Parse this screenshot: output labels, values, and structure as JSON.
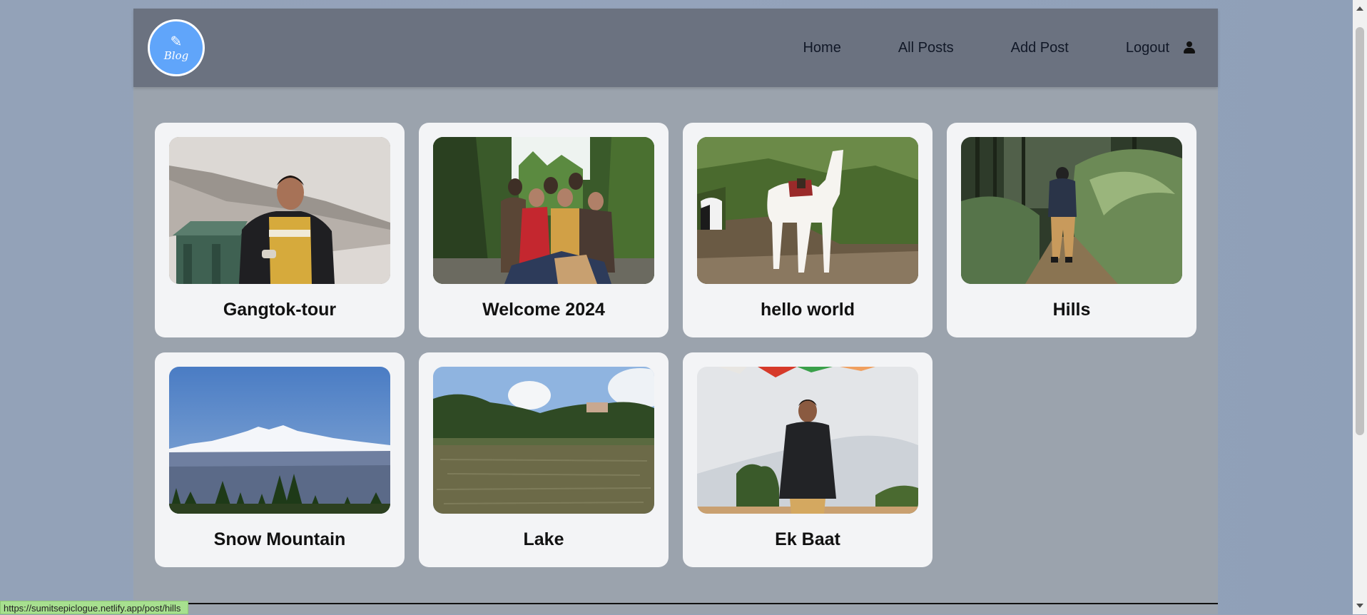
{
  "brand": {
    "logo_text": "Blog"
  },
  "nav": {
    "items": [
      {
        "label": "Home"
      },
      {
        "label": "All Posts"
      },
      {
        "label": "Add Post"
      },
      {
        "label": "Logout"
      }
    ],
    "profile_icon": "user-icon"
  },
  "posts": [
    {
      "title": "Gangtok-tour",
      "image": "snowy-hillside-portrait"
    },
    {
      "title": "Welcome 2024",
      "image": "group-in-forest"
    },
    {
      "title": "hello world",
      "image": "white-horse"
    },
    {
      "title": "Hills",
      "image": "forest-trail"
    },
    {
      "title": "Snow Mountain",
      "image": "snow-mountain-range"
    },
    {
      "title": "Lake",
      "image": "lake-with-trees"
    },
    {
      "title": "Ek Baat",
      "image": "portrait-with-prayer-flags"
    }
  ],
  "status_url": "https://sumitsepiclogue.netlify.app/post/hills",
  "colors": {
    "navbar": "#6b7280",
    "card": "#f3f4f6",
    "logo": "#60a5fa"
  }
}
